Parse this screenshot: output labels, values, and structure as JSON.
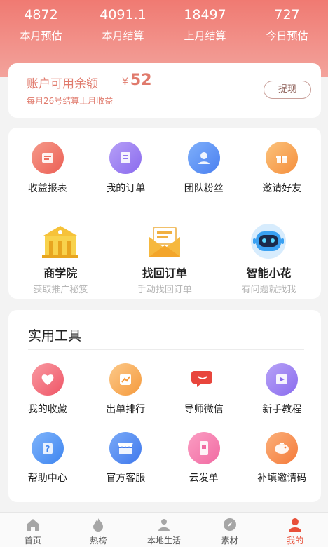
{
  "stats": [
    {
      "value": "4872",
      "label": "本月预估"
    },
    {
      "value": "4091.1",
      "label": "本月结算"
    },
    {
      "value": "18497",
      "label": "上月结算"
    },
    {
      "value": "727",
      "label": "今日预估"
    }
  ],
  "balance": {
    "title": "账户可用余额",
    "currency": "¥",
    "amount": "52",
    "subtitle": "每月26号结算上月收益",
    "withdraw_label": "提现"
  },
  "menu": {
    "row1": [
      {
        "label": "收益报表",
        "icon": "report-icon",
        "color": "#f07a6a"
      },
      {
        "label": "我的订单",
        "icon": "order-icon",
        "color": "#9d7ff2"
      },
      {
        "label": "团队粉丝",
        "icon": "team-icon",
        "color": "#5b8ff5"
      },
      {
        "label": "邀请好友",
        "icon": "gift-icon",
        "color": "#f8a659"
      }
    ],
    "row2": [
      {
        "label": "商学院",
        "sub": "获取推广秘笈",
        "icon": "academy-icon"
      },
      {
        "label": "找回订单",
        "sub": "手动找回订单",
        "icon": "envelope-icon"
      },
      {
        "label": "智能小花",
        "sub": "有问题就找我",
        "icon": "robot-icon"
      }
    ]
  },
  "tools": {
    "title": "实用工具",
    "row1": [
      {
        "label": "我的收藏",
        "icon": "heart-icon",
        "color": "#f36b78"
      },
      {
        "label": "出单排行",
        "icon": "ranking-icon",
        "color": "#f8a24e"
      },
      {
        "label": "导师微信",
        "icon": "chat-icon",
        "color": "#e8453c"
      },
      {
        "label": "新手教程",
        "icon": "video-icon",
        "color": "#9d7ff2"
      }
    ],
    "row2": [
      {
        "label": "帮助中心",
        "icon": "help-icon",
        "color": "#4e8ff5"
      },
      {
        "label": "官方客服",
        "icon": "store-icon",
        "color": "#4f86f0"
      },
      {
        "label": "云发单",
        "icon": "phone-icon",
        "color": "#f36ba0"
      },
      {
        "label": "补填邀请码",
        "icon": "piggy-icon",
        "color": "#f5863a"
      }
    ]
  },
  "tabbar": [
    {
      "label": "首页",
      "icon": "home-icon"
    },
    {
      "label": "热榜",
      "icon": "fire-icon"
    },
    {
      "label": "本地生活",
      "icon": "location-icon"
    },
    {
      "label": "素材",
      "icon": "compass-icon"
    },
    {
      "label": "我的",
      "icon": "user-icon",
      "active": true
    }
  ]
}
